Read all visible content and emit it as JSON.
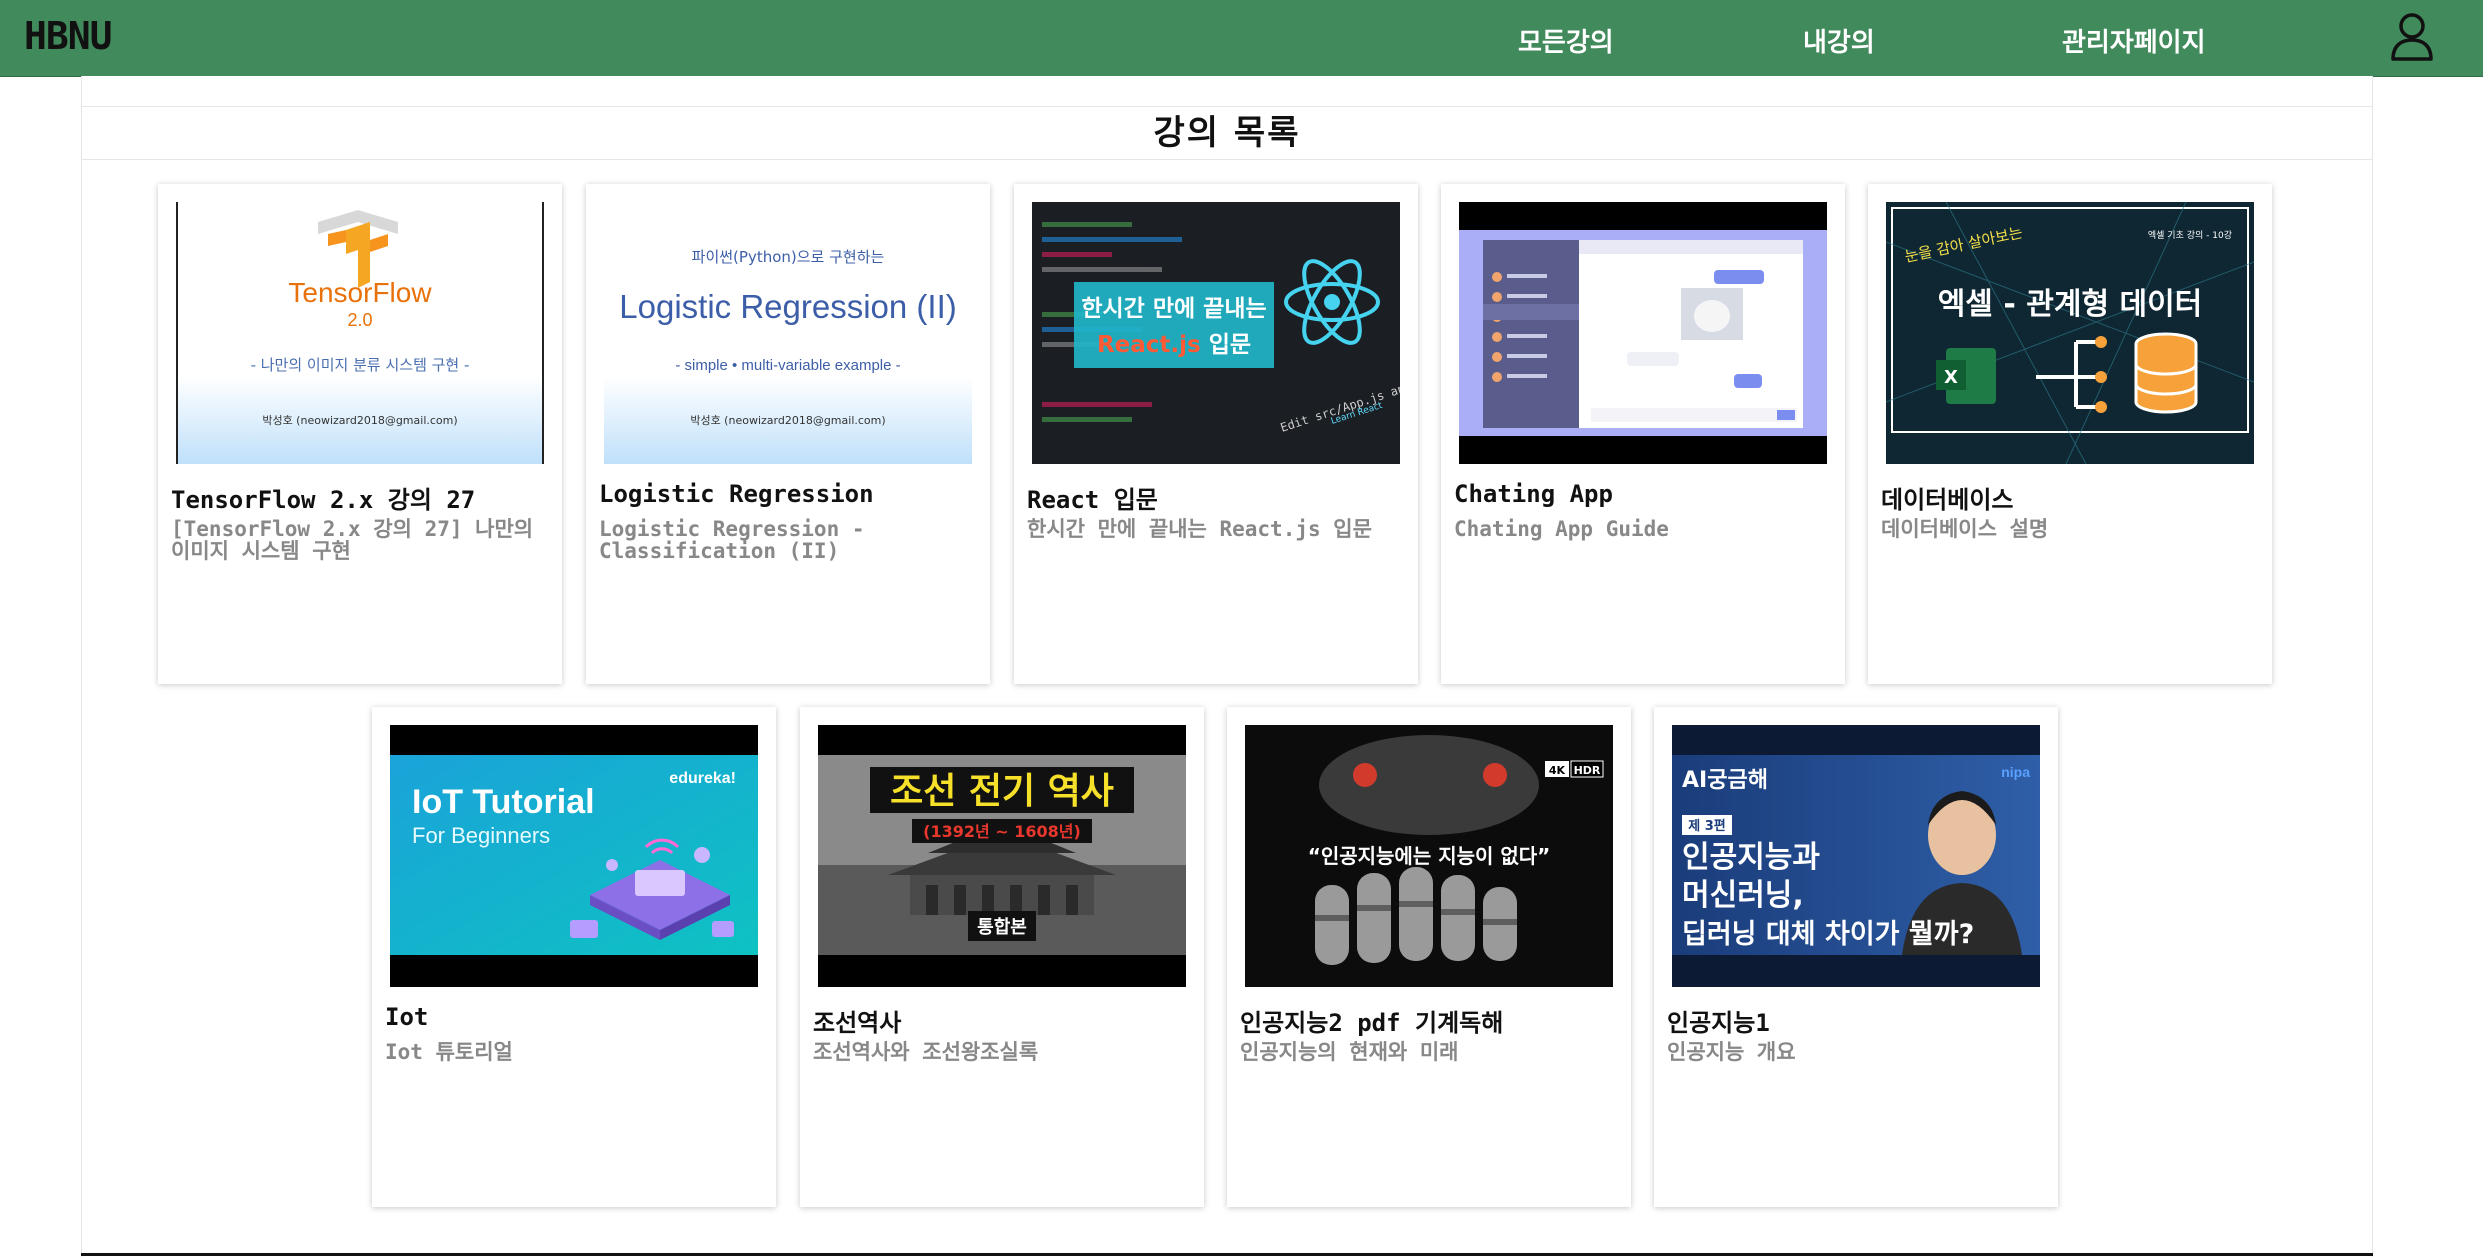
{
  "app": {
    "brand": "HBNU"
  },
  "nav": {
    "all_courses": "모든강의",
    "my_courses": "내강의",
    "admin_page": "관리자페이지",
    "user_icon": "user-icon"
  },
  "page": {
    "title": "강의 목록"
  },
  "courses": [
    {
      "title": "TensorFlow 2.x 강의 27",
      "description": "[TensorFlow 2.x 강의 27] 나만의 이미지 시스템 구현",
      "thumb": {
        "logo_text": "TensorFlow",
        "version": "2.0",
        "subtitle": "- 나만의 이미지 분류 시스템 구현 -",
        "author": "박성호 (neowizard2018@gmail.com)"
      }
    },
    {
      "title": "Logistic Regression",
      "description": "Logistic Regression - Classification (II)",
      "thumb": {
        "top_text": "파이썬(Python)으로 구현하는",
        "main_text": "Logistic Regression (II)",
        "subtitle": "- simple • multi-variable example -",
        "author": "박성호 (neowizard2018@gmail.com)"
      }
    },
    {
      "title": "React 입문",
      "description": "한시간 만에 끝내는 React.js 입문",
      "thumb": {
        "line1": "한시간 만에 끝내는",
        "line2_accent": "React.js",
        "line2_rest": " 입문",
        "code_hint": "Edit src/App.js and save to re",
        "link_hint": "Learn React"
      }
    },
    {
      "title": "Chating App",
      "description": "Chating App Guide",
      "thumb": {}
    },
    {
      "title": "데이터베이스",
      "description": "데이터베이스 설명",
      "thumb": {
        "corner_text": "눈을 감아 살아보는",
        "top_right": "엑셀 기초 강의 - 10강",
        "main_text": "엑셀 - 관계형 데이터"
      }
    },
    {
      "title": "Iot",
      "description": "Iot 튜토리얼",
      "thumb": {
        "main_text": "IoT Tutorial",
        "sub_text": "For Beginners",
        "brand_text": "edureka!"
      }
    },
    {
      "title": "조선역사",
      "description": "조선역사와 조선왕조실록",
      "thumb": {
        "main_text": "조선 전기 역사",
        "years": "(1392년 ~ 1608년)",
        "badge": "통합본"
      }
    },
    {
      "title": "인공지능2 pdf 기계독해",
      "description": "인공지능의 현재와 미래",
      "thumb": {
        "quote": "“인공지능에는 지능이 없다”",
        "badge_4k": "4K",
        "badge_hdr": "HDR"
      }
    },
    {
      "title": "인공지능1",
      "description": "인공지능 개요",
      "thumb": {
        "brand": "AI궁금해",
        "episode": "제 3편",
        "line1": "인공지능과",
        "line2": "머신러닝,",
        "line3": "딥러닝 대체 차이가 뭘까?",
        "channel": "nipa"
      }
    }
  ]
}
